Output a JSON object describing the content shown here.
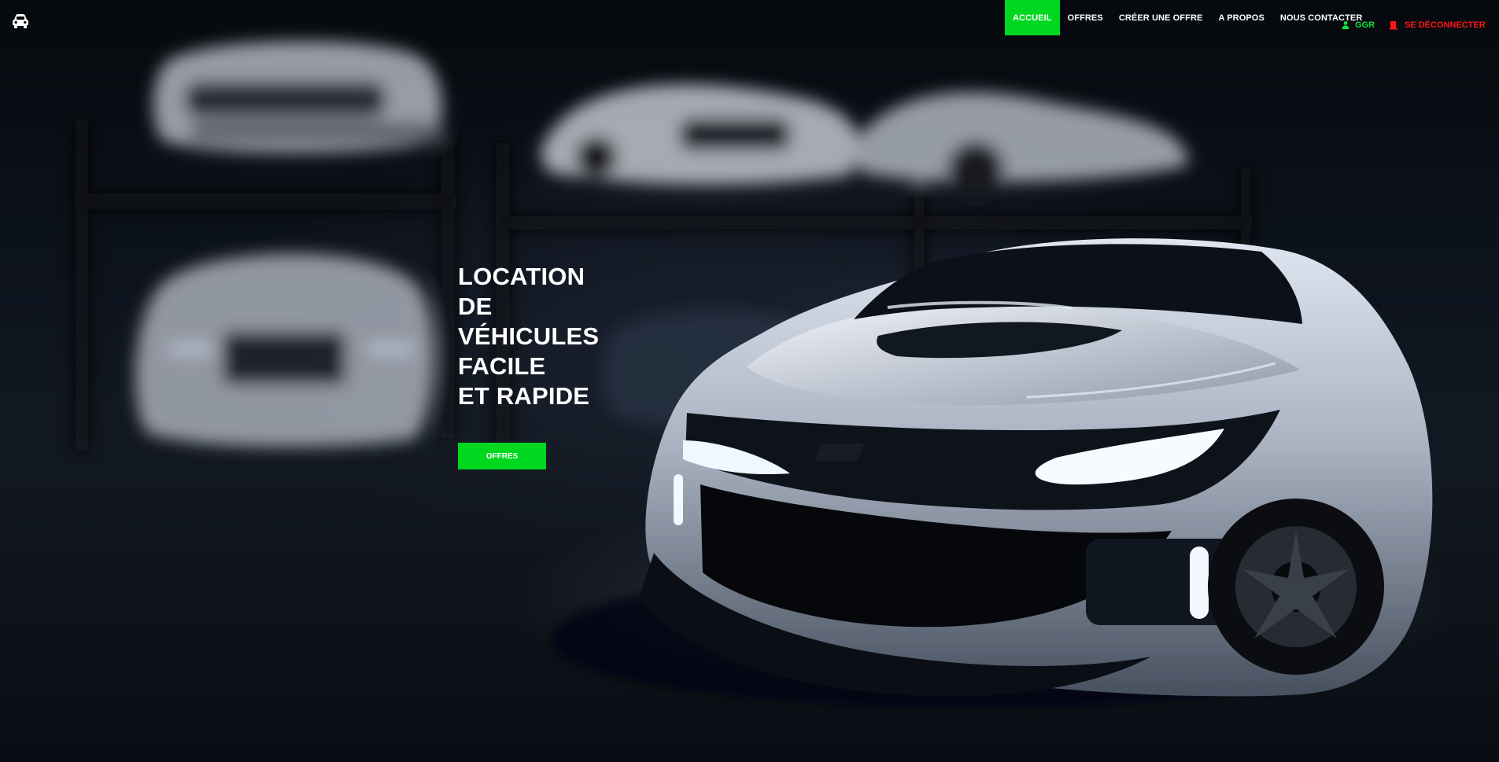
{
  "colors": {
    "accent": "#00d71f",
    "logout": "#ff1515",
    "user": "#10e040",
    "text": "#ffffff"
  },
  "navbar": {
    "brand_icon": "car-icon",
    "links": [
      {
        "label": "ACCUEIL",
        "active": true
      },
      {
        "label": "OFFRES",
        "active": false
      },
      {
        "label": "CRÉER UNE OFFRE",
        "active": false
      },
      {
        "label": "A PROPOS",
        "active": false
      },
      {
        "label": "NOUS CONTACTER",
        "active": false
      }
    ],
    "user": {
      "icon": "user-icon",
      "label": "GGR"
    },
    "logout": {
      "icon": "logout-icon",
      "label": "SE DÉCONNECTER"
    }
  },
  "hero": {
    "headline_lines": [
      "LOCATION",
      "DE",
      "VÉHICULES",
      "FACILE",
      "ET RAPIDE"
    ],
    "button_label": "OFFRES",
    "background_icon": "sports-car-image"
  }
}
